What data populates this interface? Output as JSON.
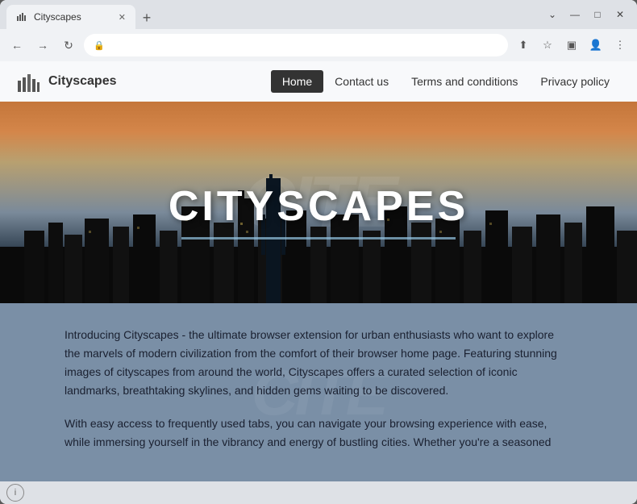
{
  "browser": {
    "tab_title": "Cityscapes",
    "tab_new_label": "+",
    "controls": {
      "minimize": "—",
      "maximize": "□",
      "close": "✕",
      "chevron_down": "⌄",
      "back": "←",
      "forward": "→",
      "reload": "↻",
      "lock": "🔒",
      "share": "⬆",
      "star": "☆",
      "extensions": "▣",
      "profile": "👤",
      "more": "⋮"
    }
  },
  "nav": {
    "logo_text": "Cityscapes",
    "links": [
      {
        "label": "Home",
        "active": true
      },
      {
        "label": "Contact us",
        "active": false
      },
      {
        "label": "Terms and conditions",
        "active": false
      },
      {
        "label": "Privacy policy",
        "active": false
      }
    ]
  },
  "hero": {
    "watermark": "CITE",
    "title": "CITYSCAPES",
    "underline": true
  },
  "info": {
    "watermark": "CITE",
    "paragraph1": "Introducing Cityscapes - the ultimate browser extension for urban enthusiasts who want to explore the marvels of modern civilization from the comfort of their browser home page. Featuring stunning images of cityscapes from around the world, Cityscapes offers a curated selection of iconic landmarks, breathtaking skylines, and hidden gems waiting to be discovered.",
    "paragraph2": "With easy access to frequently used tabs, you can navigate your browsing experience with ease, while immersing yourself in the vibrancy and energy of bustling cities. Whether you're a seasoned"
  },
  "colors": {
    "nav_active_bg": "#333333",
    "nav_active_text": "#ffffff",
    "hero_title": "#ffffff",
    "info_bg": "#7a8fa6",
    "info_text": "#1a2030"
  }
}
